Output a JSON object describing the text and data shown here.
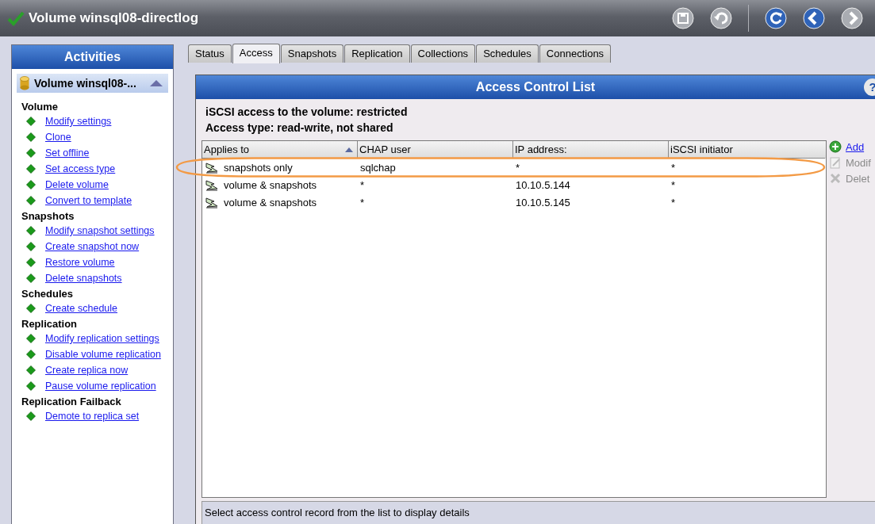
{
  "window": {
    "title": "Volume winsql08-directlog"
  },
  "toolbar": [
    {
      "kind": "save",
      "disabled": true
    },
    {
      "kind": "undo",
      "disabled": true
    },
    {
      "kind": "refresh",
      "disabled": false
    },
    {
      "kind": "back",
      "disabled": false
    },
    {
      "kind": "forward",
      "disabled": true
    }
  ],
  "sidebar": {
    "title": "Activities",
    "object": {
      "label": "Volume winsql08-...",
      "expanded": true
    },
    "sections": [
      {
        "heading": "Volume",
        "items": [
          "Modify settings",
          "Clone",
          "Set offline",
          "Set access type",
          "Delete volume",
          "Convert to template"
        ]
      },
      {
        "heading": "Snapshots",
        "items": [
          "Modify snapshot settings",
          "Create snapshot now",
          "Restore volume",
          "Delete snapshots"
        ]
      },
      {
        "heading": "Schedules",
        "items": [
          "Create schedule"
        ]
      },
      {
        "heading": "Replication",
        "items": [
          "Modify replication settings",
          "Disable volume replication",
          "Create replica now",
          "Pause volume replication"
        ]
      },
      {
        "heading": "Replication Failback",
        "items": [
          "Demote to replica set"
        ]
      }
    ]
  },
  "tabs": [
    {
      "label": "Status",
      "selected": false
    },
    {
      "label": "Access",
      "selected": true
    },
    {
      "label": "Snapshots",
      "selected": false
    },
    {
      "label": "Replication",
      "selected": false
    },
    {
      "label": "Collections",
      "selected": false
    },
    {
      "label": "Schedules",
      "selected": false
    },
    {
      "label": "Connections",
      "selected": false
    }
  ],
  "panel": {
    "title": "Access Control List",
    "help": "?",
    "info": [
      "iSCSI access to the volume:  restricted",
      "Access type: read-write, not shared"
    ],
    "table": {
      "columns": [
        {
          "label": "Applies to",
          "sorted": true
        },
        {
          "label": "CHAP user",
          "sorted": false
        },
        {
          "label": "IP address:",
          "sorted": false
        },
        {
          "label": "iSCSI initiator",
          "sorted": false
        }
      ],
      "rows": [
        [
          "snapshots only",
          "sqlchap",
          "*",
          "*"
        ],
        [
          "volume & snapshots",
          "*",
          "10.10.5.144",
          "*"
        ],
        [
          "volume & snapshots",
          "*",
          "10.10.5.145",
          "*"
        ]
      ]
    },
    "actions": [
      {
        "kind": "add",
        "label": "Add",
        "disabled": false
      },
      {
        "kind": "modify",
        "label": "Modif",
        "disabled": true
      },
      {
        "kind": "delete",
        "label": "Delet",
        "disabled": true
      }
    ],
    "status": "Select access control record from the list to display details"
  }
}
